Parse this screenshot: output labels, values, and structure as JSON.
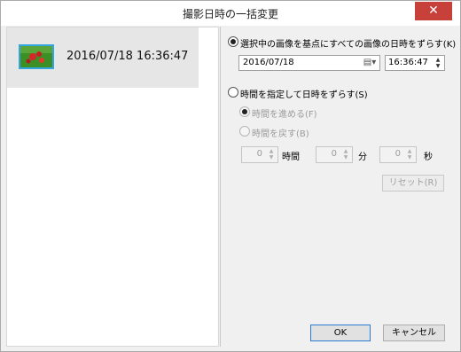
{
  "window": {
    "title": "撮影日時の一括変更",
    "close_glyph": "✕"
  },
  "list": {
    "items": [
      {
        "datetime": "2016/07/18 16:36:47"
      }
    ]
  },
  "option_selected": {
    "label": "選択中の画像を基点にすべての画像の日時をずらす(K)",
    "date_value": "2016/07/18",
    "calendar_glyph": "▤▾",
    "time_value": "16:36:47"
  },
  "option_time": {
    "label": "時間を指定して日時をずらす(S)",
    "advance_label": "時間を進める(F)",
    "rewind_label": "時間を戻す(B)",
    "hours": {
      "value": "0",
      "unit": "時間"
    },
    "minutes": {
      "value": "0",
      "unit": "分"
    },
    "seconds": {
      "value": "0",
      "unit": "秒"
    },
    "reset_label": "リセット(R)"
  },
  "footer": {
    "ok_label": "OK",
    "cancel_label": "キャンセル"
  },
  "colors": {
    "close_bg": "#c7403a",
    "thumb_border": "#33a6e0"
  }
}
